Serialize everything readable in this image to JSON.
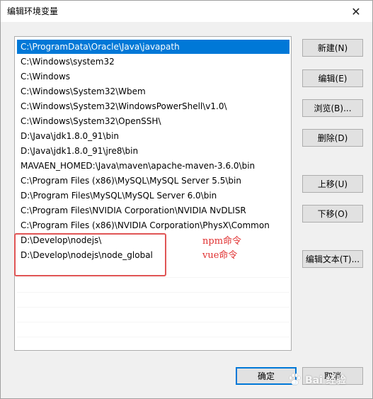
{
  "window": {
    "title": "编辑环境变量",
    "close_glyph": "✕"
  },
  "list": {
    "items": [
      "C:\\ProgramData\\Oracle\\Java\\javapath",
      "C:\\Windows\\system32",
      "C:\\Windows",
      "C:\\Windows\\System32\\Wbem",
      "C:\\Windows\\System32\\WindowsPowerShell\\v1.0\\",
      "C:\\Windows\\System32\\OpenSSH\\",
      "D:\\Java\\jdk1.8.0_91\\bin",
      "D:\\Java\\jdk1.8.0_91\\jre8\\bin",
      "MAVAEN_HOMED:\\Java\\maven\\apache-maven-3.6.0\\bin",
      "C:\\Program Files (x86)\\MySQL\\MySQL Server 5.5\\bin",
      "D:\\Program Files\\MySQL\\MySQL Server 6.0\\bin",
      "C:\\Program Files\\NVIDIA Corporation\\NVIDIA NvDLISR",
      "C:\\Program Files (x86)\\NVIDIA Corporation\\PhysX\\Common",
      "D:\\Develop\\nodejs\\",
      "D:\\Develop\\nodejs\\node_global"
    ],
    "selected_index": 0
  },
  "buttons": {
    "new": "新建(N)",
    "edit": "编辑(E)",
    "browse": "浏览(B)...",
    "delete": "删除(D)",
    "move_up": "上移(U)",
    "move_down": "下移(O)",
    "edit_text": "编辑文本(T)...",
    "ok": "确定",
    "cancel": "取消"
  },
  "annotations": {
    "npm": "npm命令",
    "vue": "vue命令"
  },
  "watermark": {
    "text": "Bai 经验"
  },
  "colors": {
    "selection": "#0078d7",
    "annotation_red": "#e05555"
  }
}
